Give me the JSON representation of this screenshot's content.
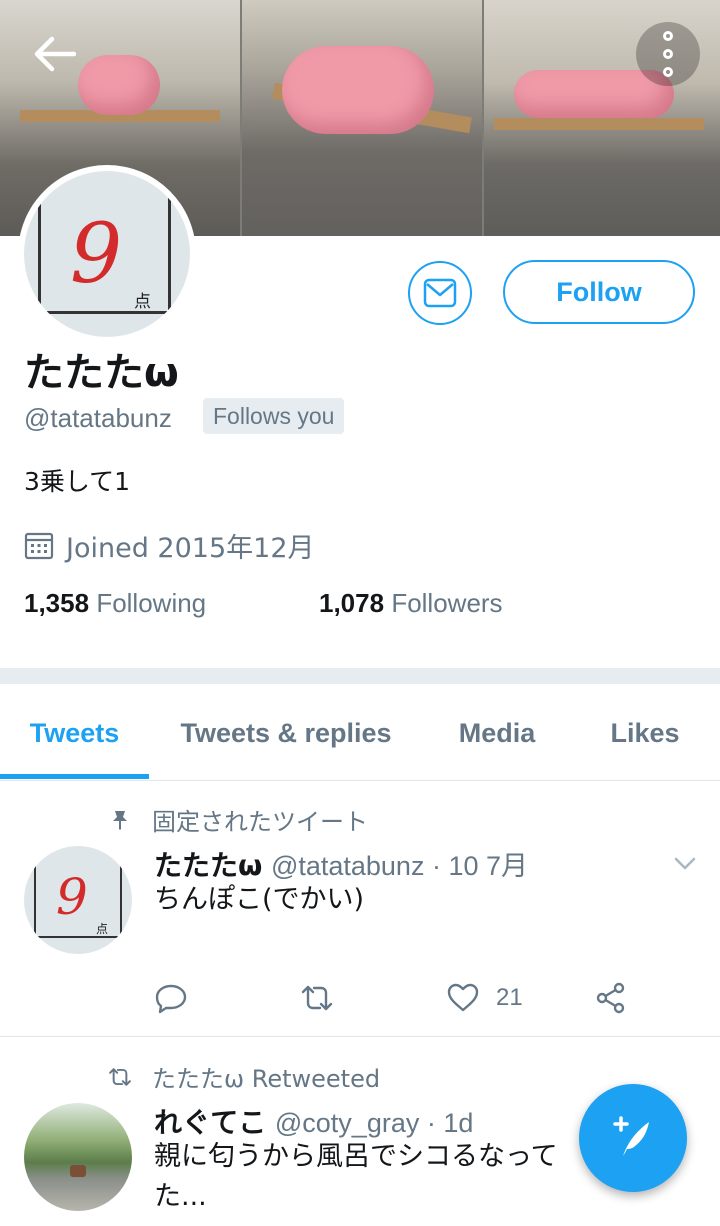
{
  "profile": {
    "name": "たたたω",
    "handle": "@tatatabunz",
    "follows_you": "Follows you",
    "bio": "3乗して1",
    "joined": "Joined 2015年12月",
    "following_count": "1,358",
    "following_label": "Following",
    "followers_count": "1,078",
    "followers_label": "Followers",
    "avatar_mark": "9",
    "avatar_small_mark": "点"
  },
  "buttons": {
    "follow": "Follow"
  },
  "tabs": [
    {
      "label": "Tweets",
      "active": true
    },
    {
      "label": "Tweets & replies",
      "active": false
    },
    {
      "label": "Media",
      "active": false
    },
    {
      "label": "Likes",
      "active": false
    }
  ],
  "tweets": [
    {
      "context": "固定されたツイート",
      "context_icon": "pin-icon",
      "author": "たたたω",
      "meta": "@tatatabunz · 10 7月",
      "text": "ちんぽこ(でかい)",
      "likes": "21"
    },
    {
      "context": "たたたω Retweeted",
      "context_icon": "retweet-icon",
      "author": "れぐてこ",
      "meta": "@coty_gray · 1d",
      "text_line1": "親に匂うから風呂でシコるなって",
      "text_line2": "た..."
    }
  ],
  "colors": {
    "accent": "#1da1f2",
    "secondary_text": "#657786",
    "divider": "#e6ecf0"
  }
}
